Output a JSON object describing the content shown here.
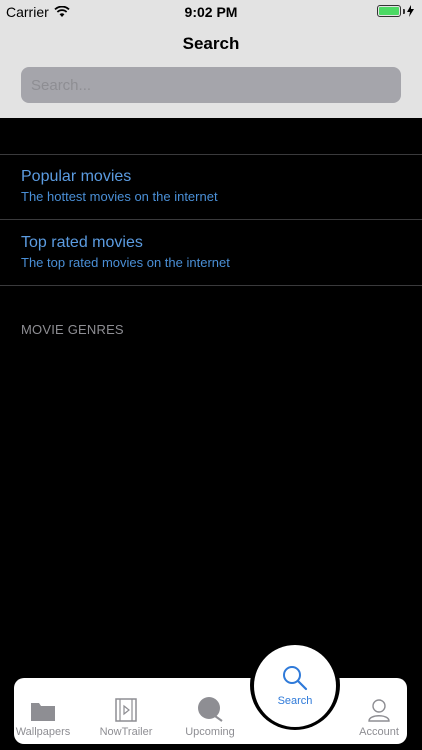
{
  "status_bar": {
    "carrier": "Carrier",
    "time": "9:02 PM"
  },
  "header": {
    "title": "Search",
    "search_placeholder": "Search..."
  },
  "menu": [
    {
      "title": "Popular movies",
      "subtitle": "The hottest movies on the internet"
    },
    {
      "title": "Top rated movies",
      "subtitle": "The top rated movies on the internet"
    }
  ],
  "section": {
    "genres_header": "MOVIE GENRES"
  },
  "tabs": [
    {
      "label": "Wallpapers",
      "icon": "folder-icon"
    },
    {
      "label": "NowTrailer",
      "icon": "film-icon"
    },
    {
      "label": "Upcoming",
      "icon": "clapper-icon"
    },
    {
      "label": "Search",
      "icon": "search-icon"
    },
    {
      "label": "Account",
      "icon": "person-icon"
    }
  ],
  "colors": {
    "accent": "#2f7ad9",
    "link": "#5b9be0",
    "header_bg": "#e3e3e3",
    "battery": "#4cd964"
  }
}
